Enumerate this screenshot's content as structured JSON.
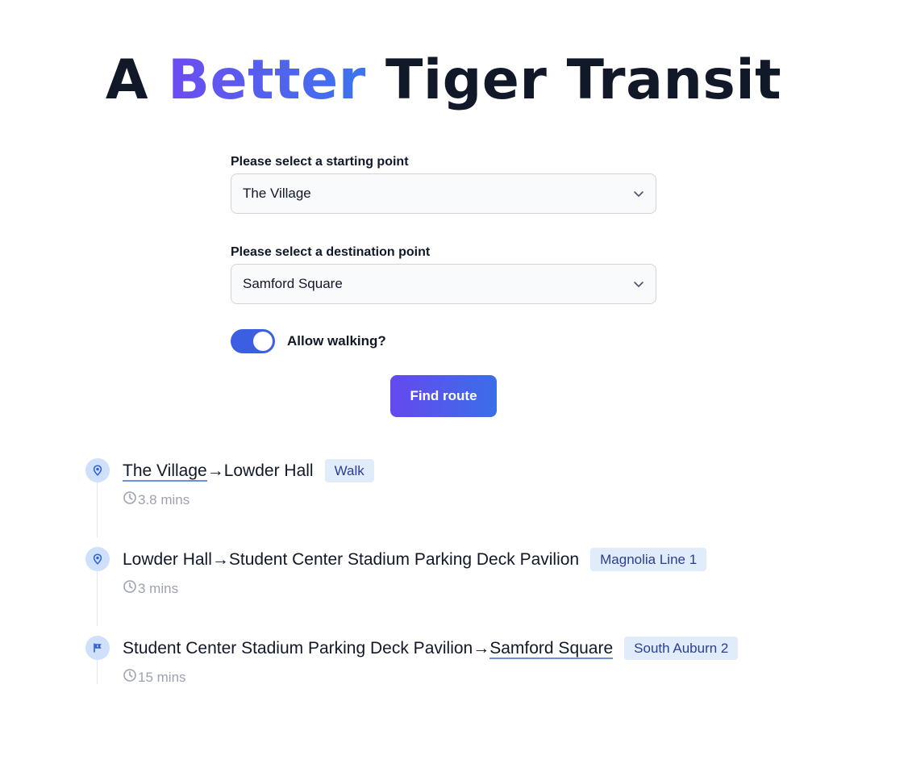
{
  "title": {
    "prefix": "A ",
    "accent": "Better",
    "suffix": " Tiger Transit"
  },
  "form": {
    "start_label": "Please select a starting point",
    "start_value": "The Village",
    "dest_label": "Please select a destination point",
    "dest_value": "Samford Square",
    "walking_label": "Allow walking?",
    "walking_enabled": true,
    "find_button": "Find route"
  },
  "route": [
    {
      "from": "The Village",
      "arrow": "→",
      "to": "Lowder Hall",
      "mode": "Walk",
      "duration": "3.8 mins",
      "icon": "map-pin-icon"
    },
    {
      "from": "Lowder Hall",
      "arrow": "→",
      "to": "Student Center Stadium Parking Deck Pavilion",
      "mode": "Magnolia Line 1",
      "duration": "3 mins",
      "icon": "map-pin-icon"
    },
    {
      "from": "Student Center Stadium Parking Deck Pavilion",
      "arrow": "→",
      "to": "Samford Square",
      "mode": "South Auburn 2",
      "duration": "15 mins",
      "icon": "flag-icon"
    }
  ],
  "colors": {
    "accent": "#5b5ef0",
    "toggle": "#3b5fe0",
    "badge_bg": "#e1ecfb",
    "badge_text": "#2c3e91"
  }
}
